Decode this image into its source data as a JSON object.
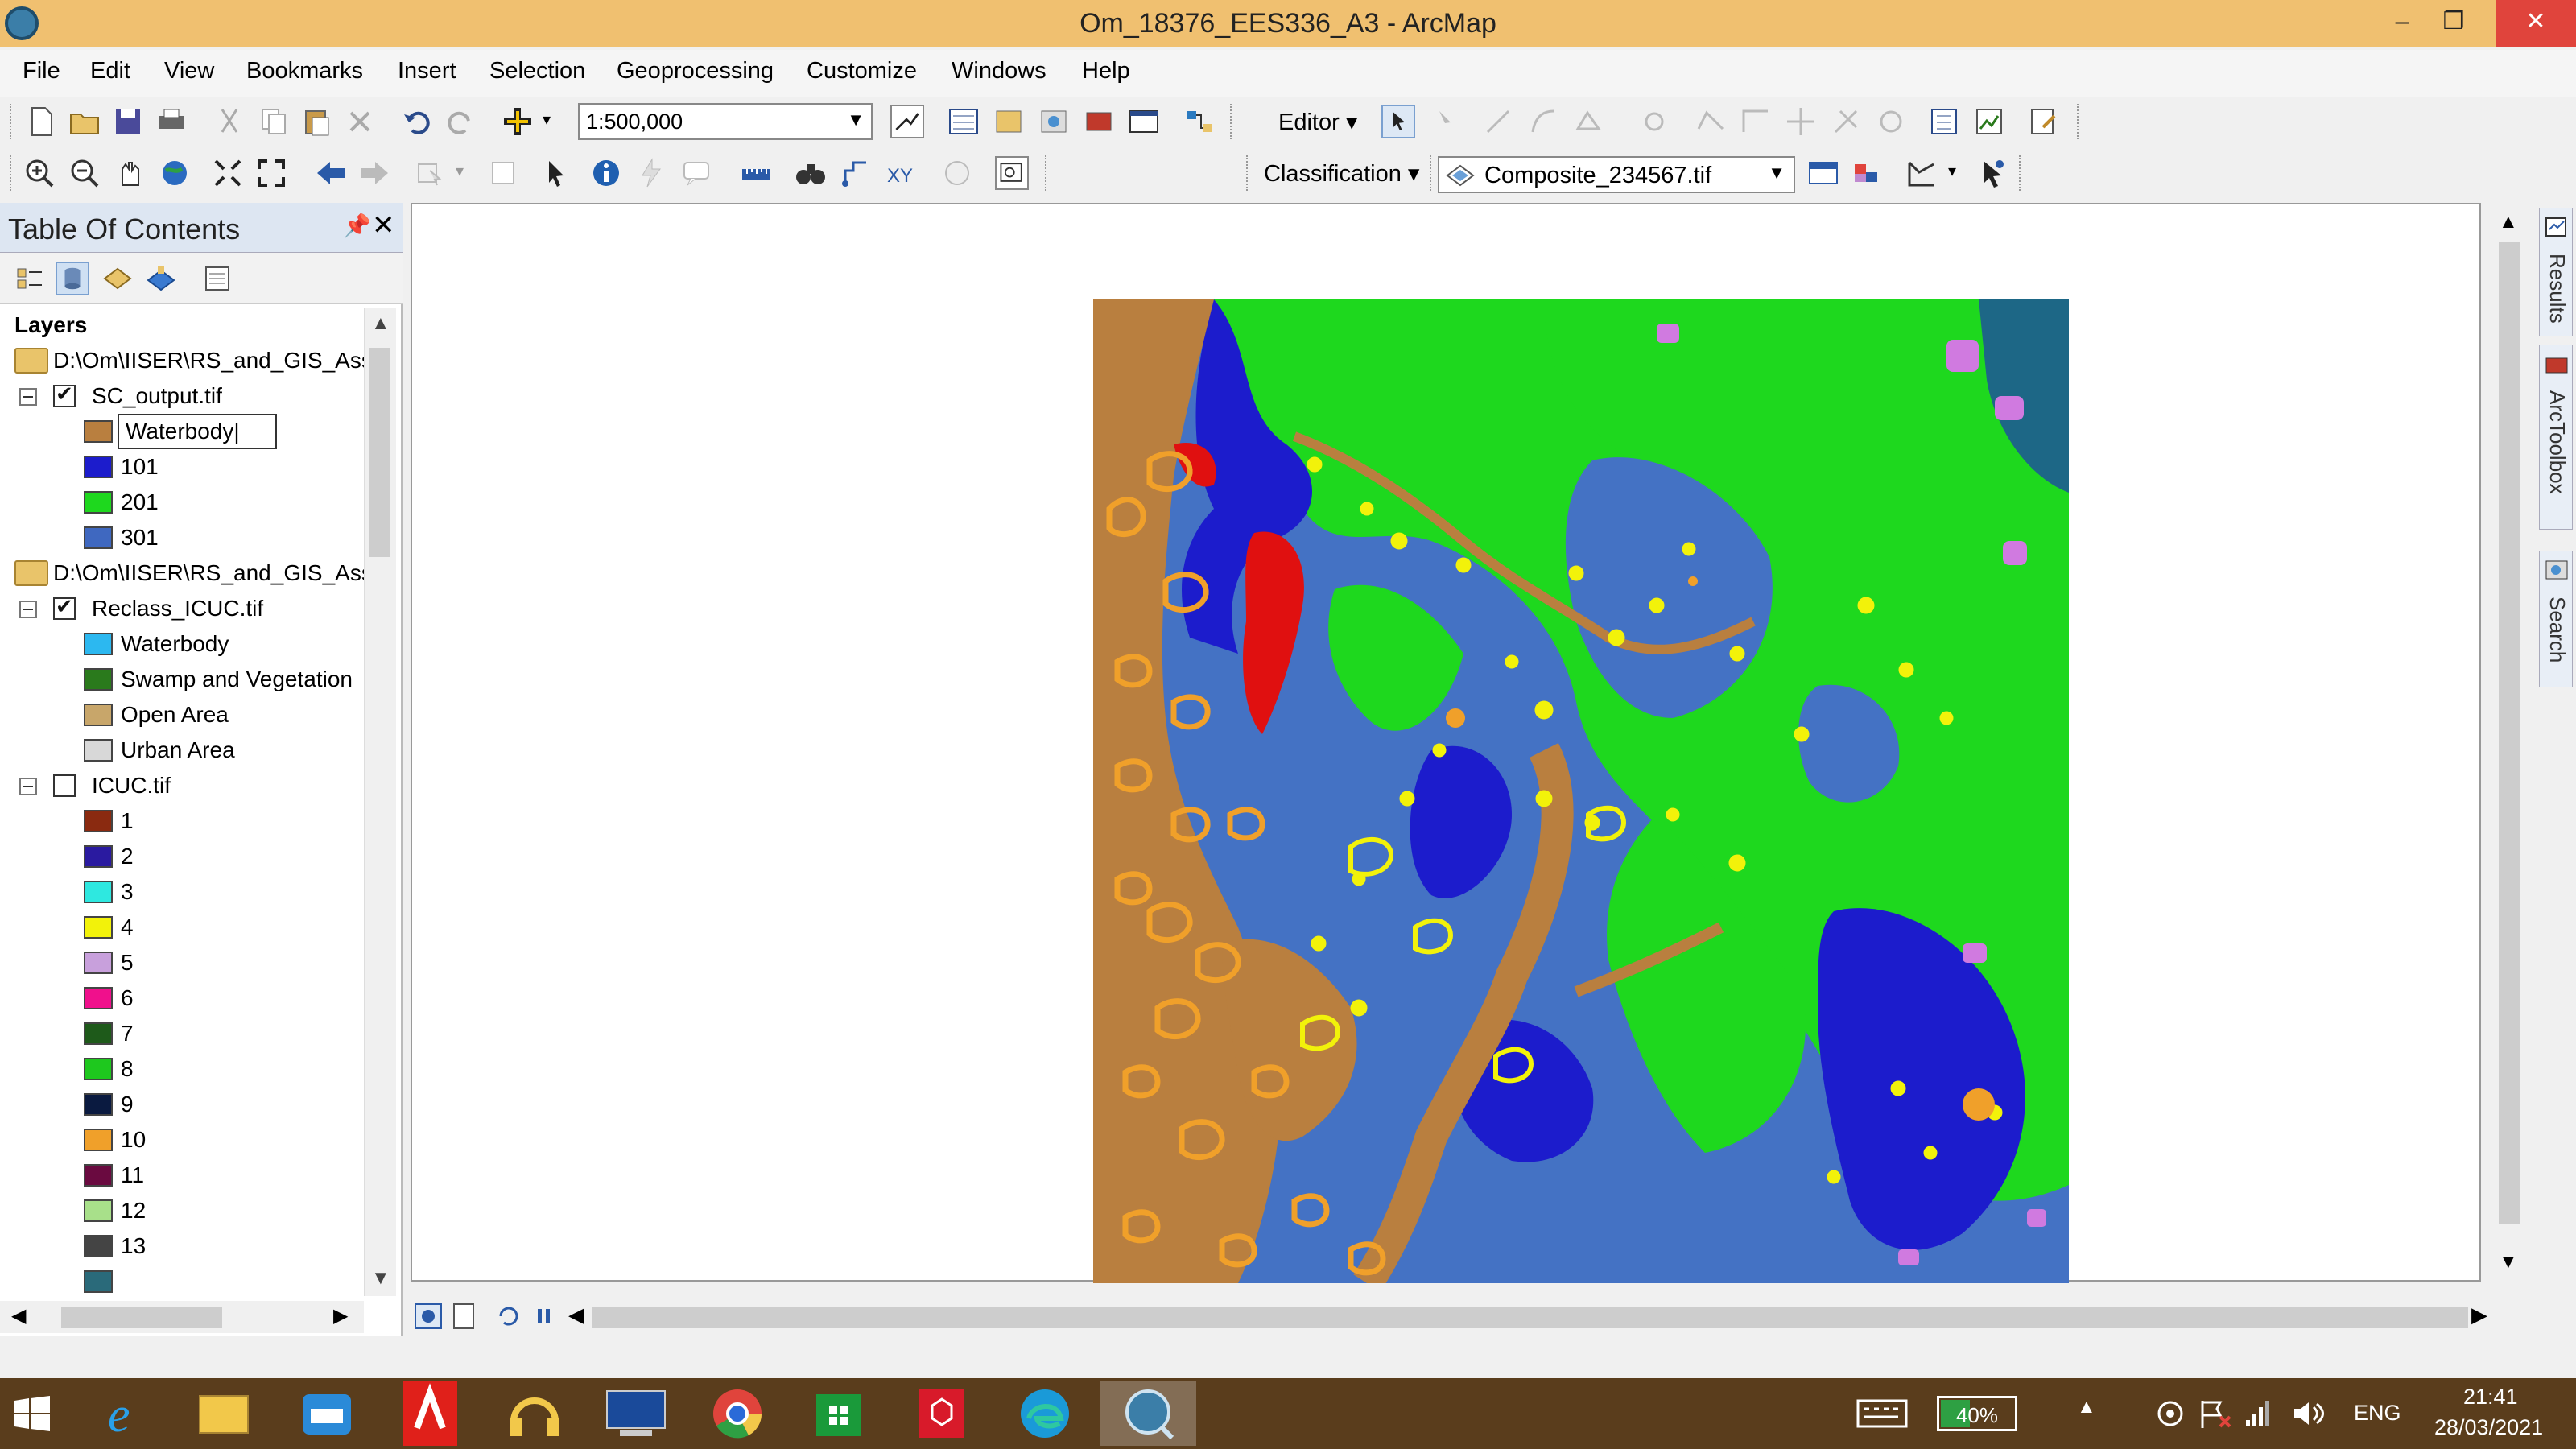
{
  "window": {
    "title": "Om_18376_EES336_A3 - ArcMap",
    "minimize": "–",
    "restore": "❐",
    "close": "✕"
  },
  "menu": [
    "File",
    "Edit",
    "View",
    "Bookmarks",
    "Insert",
    "Selection",
    "Geoprocessing",
    "Customize",
    "Windows",
    "Help"
  ],
  "standard_toolbar": {
    "scale": "1:500,000"
  },
  "editor_toolbar": {
    "editor_label": "Editor ▾"
  },
  "classification_toolbar": {
    "label": "Classification ▾",
    "layer": "Composite_234567.tif"
  },
  "toc": {
    "title": "Table Of Contents",
    "pin": "ᵖ",
    "close": "✕",
    "root": "Layers",
    "groups": [
      {
        "folder": "D:\\Om\\IISER\\RS_and_GIS_Ass",
        "layer": "SC_output.tif",
        "checked": true,
        "editing_label": "Waterbody",
        "classes": [
          {
            "label": "101",
            "color": "#1c1ccc"
          },
          {
            "label": "201",
            "color": "#1ed81e"
          },
          {
            "label": "301",
            "color": "#3f68c0"
          }
        ],
        "editing_color": "#b97f3f"
      },
      {
        "folder": "D:\\Om\\IISER\\RS_and_GIS_Ass",
        "layer": "Reclass_ICUC.tif",
        "checked": true,
        "classes": [
          {
            "label": "Waterbody",
            "color": "#2cb8f0"
          },
          {
            "label": "Swamp and Vegetation",
            "color": "#2a7a1c"
          },
          {
            "label": "Open Area",
            "color": "#c8a66a"
          },
          {
            "label": "Urban Area",
            "color": "#d8d8d8"
          }
        ]
      },
      {
        "layer": "ICUC.tif",
        "checked": false,
        "classes": [
          {
            "label": "1",
            "color": "#8a2a10"
          },
          {
            "label": "2",
            "color": "#2a1aa0"
          },
          {
            "label": "3",
            "color": "#2ee8e0"
          },
          {
            "label": "4",
            "color": "#f2f20a"
          },
          {
            "label": "5",
            "color": "#c8a0dc"
          },
          {
            "label": "6",
            "color": "#f0108c"
          },
          {
            "label": "7",
            "color": "#1e5a1a"
          },
          {
            "label": "8",
            "color": "#1ec81e"
          },
          {
            "label": "9",
            "color": "#0a1a40"
          },
          {
            "label": "10",
            "color": "#f0a02a"
          },
          {
            "label": "11",
            "color": "#6a0a40"
          },
          {
            "label": "12",
            "color": "#a8e08a"
          },
          {
            "label": "13",
            "color": "#444444"
          }
        ]
      }
    ]
  },
  "right_dock": [
    "Results",
    "ArcToolbox",
    "Search"
  ],
  "taskbar": {
    "battery": "40%",
    "battery_level": 0.4,
    "language": "ENG",
    "time": "21:41",
    "date": "28/03/2021"
  },
  "colors": {
    "titlebar": "#f0c070",
    "taskbar": "#5a3d1c",
    "map_mud": "#b97f3f",
    "map_builtup": "#4472c4",
    "map_water": "#1c1ccc",
    "map_veg": "#1ed81e"
  }
}
